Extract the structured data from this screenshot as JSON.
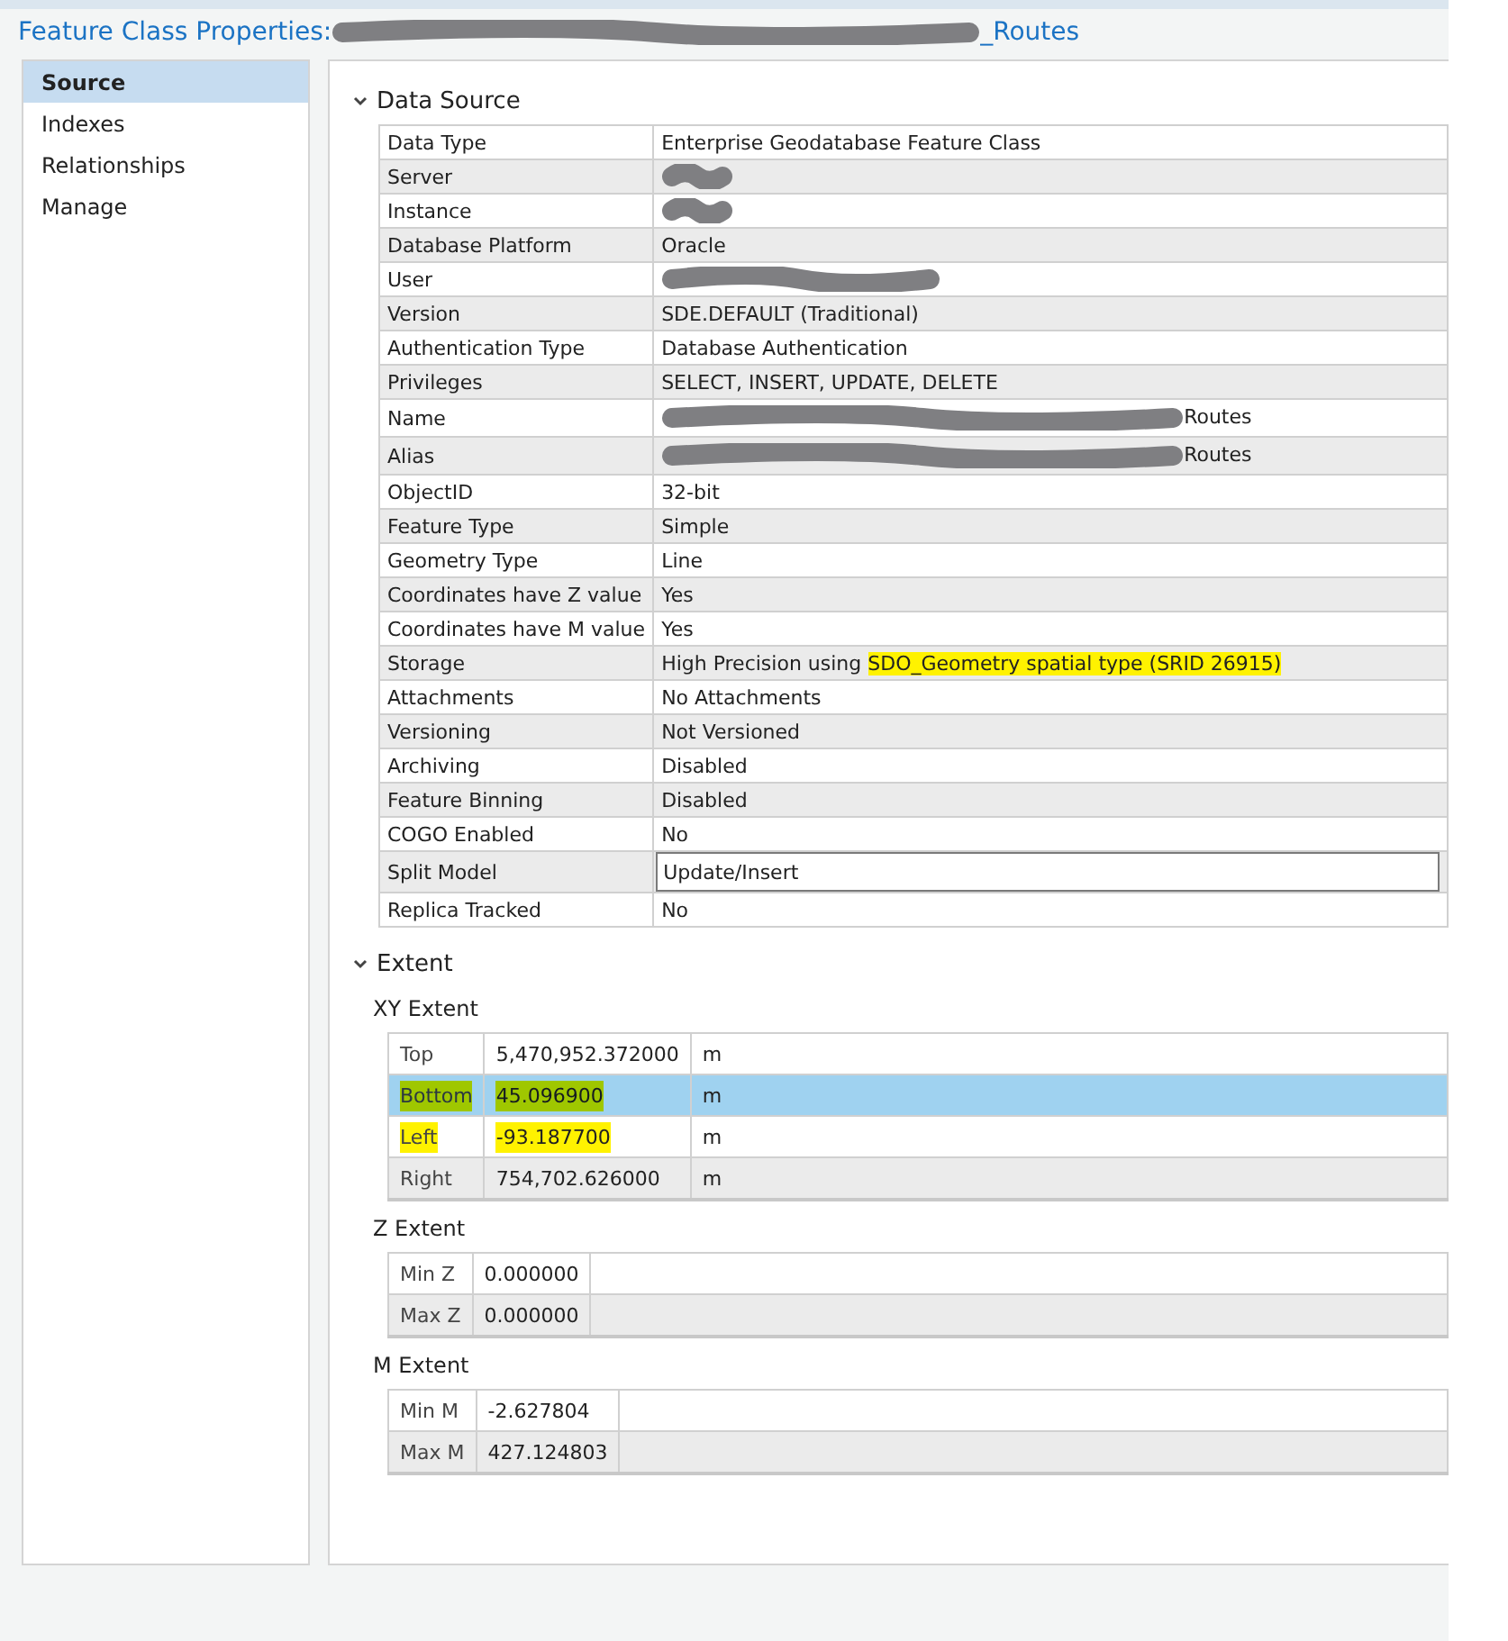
{
  "window": {
    "title_start": "Feature Class Properties:",
    "title_end": "_Routes",
    "title_redacted": true
  },
  "sidebar": {
    "items": [
      {
        "label": "Source",
        "selected": true
      },
      {
        "label": "Indexes",
        "selected": false
      },
      {
        "label": "Relationships",
        "selected": false
      },
      {
        "label": "Manage",
        "selected": false
      }
    ]
  },
  "sections": [
    {
      "kind": "properties",
      "title": "Data Source",
      "expanded": true,
      "rows": [
        {
          "label": "Data Type",
          "value": "Enterprise Geodatabase Feature Class"
        },
        {
          "label": "Server",
          "redacted": true
        },
        {
          "label": "Instance",
          "redacted": true
        },
        {
          "label": "Database Platform",
          "value": "Oracle"
        },
        {
          "label": "User",
          "redacted": true
        },
        {
          "label": "Version",
          "value": "SDE.DEFAULT (Traditional)"
        },
        {
          "label": "Authentication Type",
          "value": "Database Authentication"
        },
        {
          "label": "Privileges",
          "value": "SELECT, INSERT, UPDATE, DELETE"
        },
        {
          "label": "Name",
          "redacted": true,
          "value_end": "Routes"
        },
        {
          "label": "Alias",
          "redacted": true,
          "value_end": "Routes"
        },
        {
          "label": "ObjectID",
          "value": "32-bit"
        },
        {
          "label": "Feature Type",
          "value": "Simple"
        },
        {
          "label": "Geometry Type",
          "value": "Line"
        },
        {
          "label": "Coordinates have Z value",
          "value": "Yes"
        },
        {
          "label": "Coordinates have M value",
          "value": "Yes"
        },
        {
          "label": "Storage",
          "value": "High Precision using ",
          "value_highlighted": "SDO_Geometry spatial type (SRID 26915)"
        },
        {
          "label": "Attachments",
          "value": "No Attachments"
        },
        {
          "label": "Versioning",
          "value": "Not Versioned"
        },
        {
          "label": "Archiving",
          "value": "Disabled"
        },
        {
          "label": "Feature Binning",
          "value": "Disabled"
        },
        {
          "label": "COGO Enabled",
          "value": "No"
        },
        {
          "label": "Split Model",
          "value": "Update/Insert",
          "kind": "field"
        },
        {
          "label": "Replica Tracked",
          "value": "No"
        }
      ]
    },
    {
      "kind": "extents",
      "title": "Extent",
      "expanded": true,
      "groups": [
        {
          "title": "XY Extent",
          "rows": [
            {
              "label": "Top",
              "value": "5,470,952.372000",
              "unit": "m",
              "selected": false,
              "highlighted": false
            },
            {
              "label": "Bottom",
              "value": "45.096900",
              "unit": "m",
              "selected": true,
              "highlighted": true
            },
            {
              "label": "Left",
              "value": "-93.187700",
              "unit": "m",
              "selected": false,
              "highlighted": true
            },
            {
              "label": "Right",
              "value": "754,702.626000",
              "unit": "m",
              "selected": false,
              "highlighted": false
            }
          ]
        },
        {
          "title": "Z Extent",
          "rows": [
            {
              "label": "Min Z",
              "value": "0.000000",
              "selected": false,
              "highlighted": false
            },
            {
              "label": "Max Z",
              "value": "0.000000",
              "selected": false,
              "highlighted": false
            }
          ]
        },
        {
          "title": "M Extent",
          "rows": [
            {
              "label": "Min M",
              "value": "-2.627804",
              "selected": false,
              "highlighted": false
            },
            {
              "label": "Max M",
              "value": "427.124803",
              "selected": false,
              "highlighted": false
            }
          ]
        }
      ]
    }
  ]
}
